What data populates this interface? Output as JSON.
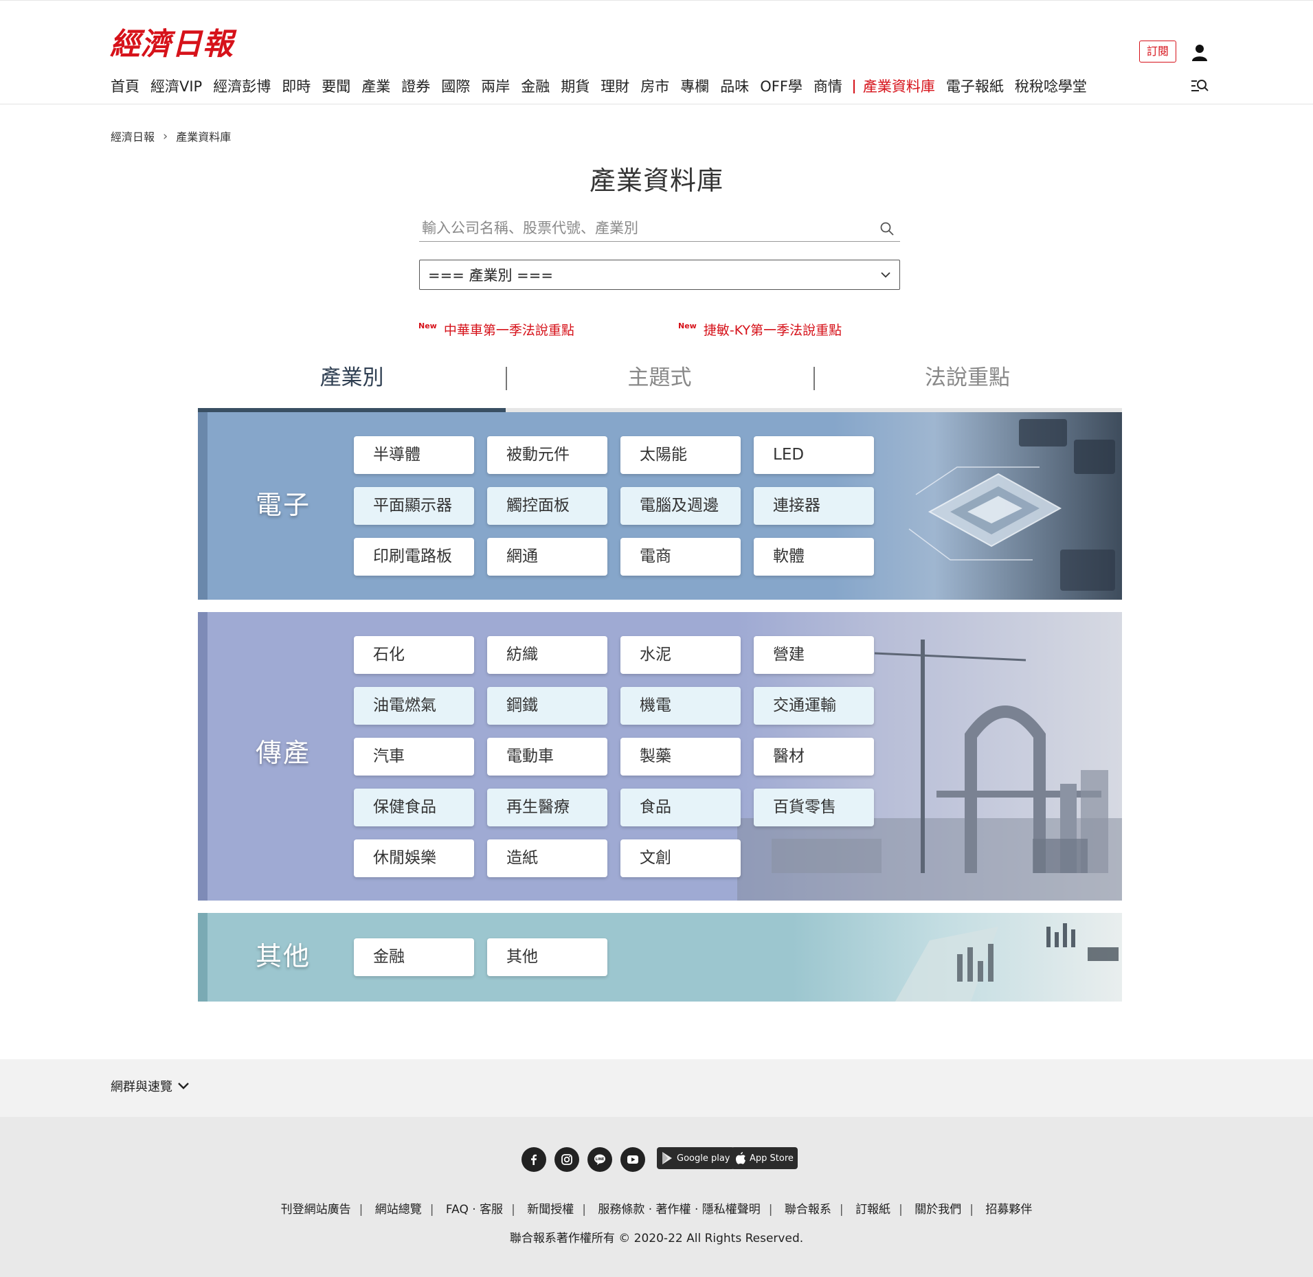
{
  "header": {
    "logo": "經濟日報",
    "subscribe": "訂閱",
    "nav": [
      "首頁",
      "經濟VIP",
      "經濟彭博",
      "即時",
      "要聞",
      "產業",
      "證券",
      "國際",
      "兩岸",
      "金融",
      "期貨",
      "理財",
      "房市",
      "專欄",
      "品味",
      "OFF學",
      "商情",
      "產業資料庫",
      "電子報紙",
      "稅稅唸學堂"
    ],
    "active_nav": "產業資料庫"
  },
  "breadcrumb": [
    "經濟日報",
    "產業資料庫"
  ],
  "title": "產業資料庫",
  "search": {
    "placeholder": "輸入公司名稱、股票代號、產業別"
  },
  "select": {
    "value": "=== 產業別 ==="
  },
  "news": [
    {
      "tag": "New",
      "text": "中華車第一季法說重點"
    },
    {
      "tag": "New",
      "text": "捷敏-KY第一季法說重點"
    }
  ],
  "tabs": [
    "產業別",
    "主題式",
    "法說重點"
  ],
  "sections": [
    {
      "title": "電子",
      "items": [
        "半導體",
        "被動元件",
        "太陽能",
        "LED",
        "平面顯示器",
        "觸控面板",
        "電腦及週邊",
        "連接器",
        "印刷電路板",
        "網通",
        "電商",
        "軟體"
      ]
    },
    {
      "title": "傳產",
      "items": [
        "石化",
        "紡織",
        "水泥",
        "營建",
        "油電燃氣",
        "鋼鐵",
        "機電",
        "交通運輸",
        "汽車",
        "電動車",
        "製藥",
        "醫材",
        "保健食品",
        "再生醫療",
        "食品",
        "百貨零售",
        "休閒娛樂",
        "造紙",
        "文創"
      ]
    },
    {
      "title": "其他",
      "items": [
        "金融",
        "其他"
      ]
    }
  ],
  "colors": {
    "brand_red": "#d6121a",
    "electronics_bg": "#86a6ca",
    "traditional_bg": "#9faad3",
    "others_bg": "#9cc6cf"
  },
  "footer": {
    "toggle": "網群與速覽",
    "social_icons": [
      "facebook-icon",
      "instagram-icon",
      "line-icon",
      "youtube-icon"
    ],
    "badges": [
      "Google play",
      "App Store"
    ],
    "links": [
      "刊登網站廣告",
      "網站總覽",
      "FAQ · 客服",
      "新聞授權",
      "服務條款 · 著作權 · 隱私權聲明",
      "聯合報系",
      "訂報紙",
      "關於我們",
      "招募夥伴"
    ],
    "copyright": "聯合報系著作權所有 © 2020-22 All Rights Reserved."
  }
}
